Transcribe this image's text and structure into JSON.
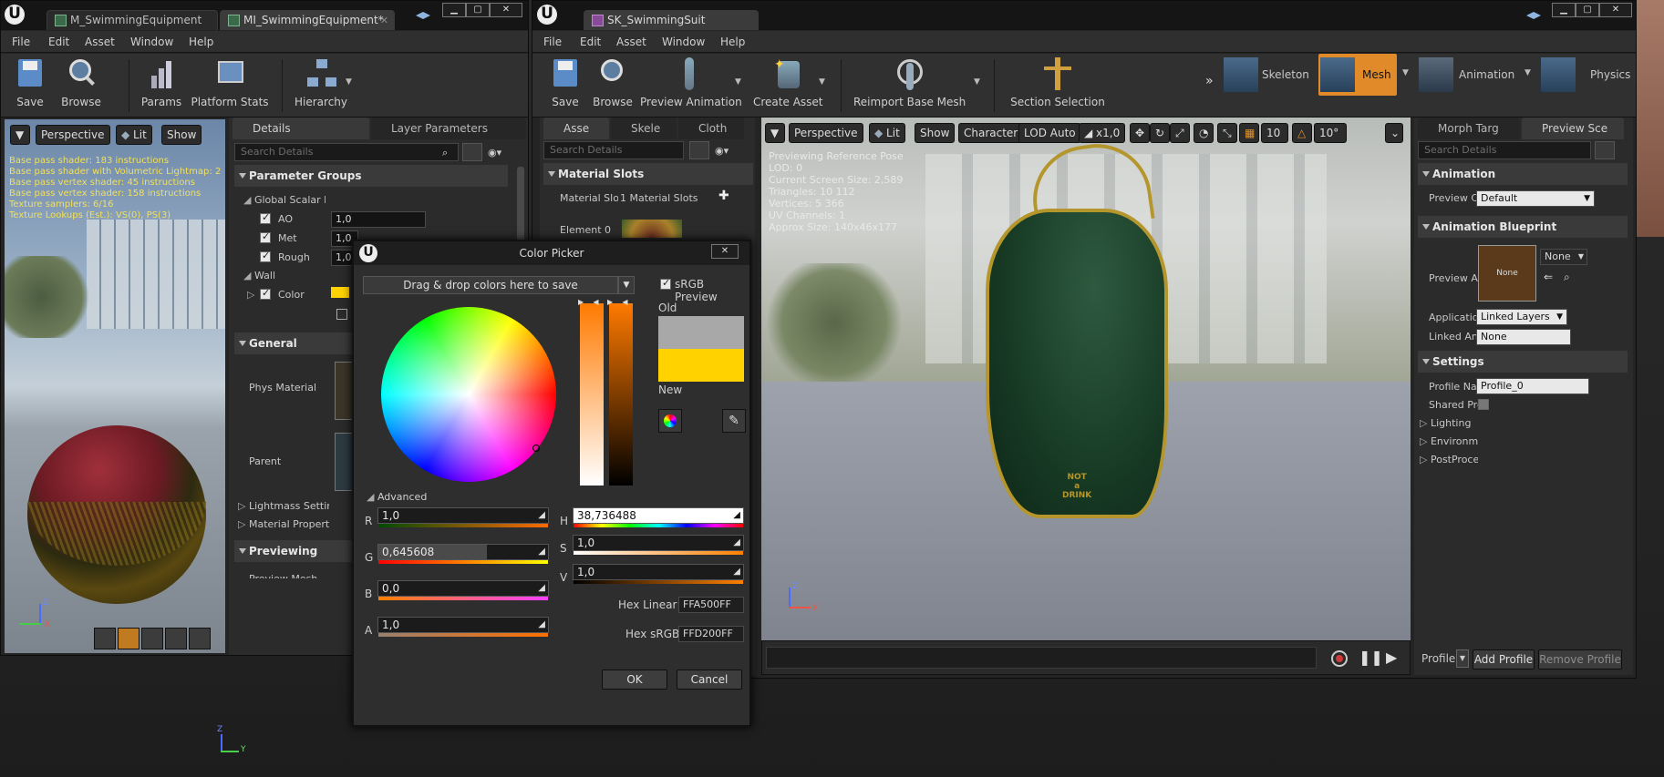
{
  "left_window": {
    "tabs": [
      {
        "label": "M_SwimmingEquipment"
      },
      {
        "label": "MI_SwimmingEquipment*"
      }
    ],
    "menu": [
      "File",
      "Edit",
      "Asset",
      "Window",
      "Help"
    ],
    "toolbar": {
      "save": "Save",
      "browse": "Browse",
      "params": "Params",
      "platform_stats": "Platform Stats",
      "hierarchy": "Hierarchy"
    },
    "viewport": {
      "perspective": "Perspective",
      "lit": "Lit",
      "show": "Show",
      "stats": [
        "Base pass shader: 183 instructions",
        "Base pass shader with Volumetric Lightmap: 2",
        "Base pass vertex shader: 45 instructions",
        "Base pass vertex shader: 158 instructions",
        "Texture samplers: 6/16",
        "Texture Lookups (Est.): VS(0), PS(3)"
      ],
      "axis_x": "X",
      "axis_z": "Z"
    },
    "details": {
      "tab_details": "Details",
      "tab_layer": "Layer Parameters",
      "search_placeholder": "Search Details",
      "parameter_groups": "Parameter Groups",
      "global_scalar": "Global Scalar Pa",
      "params": [
        {
          "name": "AO",
          "value": "1,0"
        },
        {
          "name": "Met",
          "value": "1,0"
        },
        {
          "name": "Rough",
          "value": "1,0"
        }
      ],
      "wall": "Wall",
      "color": "Color",
      "general": "General",
      "phys_material": "Phys Material",
      "parent": "Parent",
      "lightmass": "Lightmass Settir",
      "material_property": "Material Property",
      "previewing": "Previewing",
      "preview_mesh": "Preview Mesh"
    }
  },
  "color_picker": {
    "title": "Color Picker",
    "dragdrop": "Drag & drop colors here to save",
    "srgb_preview": "sRGB Preview",
    "old": "Old",
    "new": "New",
    "advanced": "Advanced",
    "r_label": "R",
    "r": "1,0",
    "g_label": "G",
    "g": "0,645608",
    "b_label": "B",
    "b": "0,0",
    "a_label": "A",
    "a": "1,0",
    "h_label": "H",
    "h": "38,736488",
    "s_label": "S",
    "s": "1,0",
    "v_label": "V",
    "v": "1,0",
    "hex_linear_label": "Hex Linear",
    "hex_linear": "FFA500FF",
    "hex_srgb_label": "Hex sRGB",
    "hex_srgb": "FFD200FF",
    "ok": "OK",
    "cancel": "Cancel",
    "old_color": "#a8a8a8",
    "new_color": "#ffd200"
  },
  "right_window": {
    "tab": "SK_SwimmingSuit",
    "menu": [
      "File",
      "Edit",
      "Asset",
      "Window",
      "Help"
    ],
    "toolbar": {
      "save": "Save",
      "browse": "Browse",
      "preview_animation": "Preview Animation",
      "create_asset": "Create Asset",
      "reimport": "Reimport Base Mesh",
      "section_selection": "Section Selection",
      "skeleton": "Skeleton",
      "mesh": "Mesh",
      "animation": "Animation",
      "physics": "Physics"
    },
    "left_panel": {
      "tabs": [
        "Asse",
        "Skele",
        "Cloth"
      ],
      "search_placeholder": "Search Details",
      "material_slots_cat": "Material Slots",
      "material_slots_label": "Material Slo",
      "material_slots_value": "1 Material Slots",
      "element0": "Element 0"
    },
    "viewport": {
      "perspective": "Perspective",
      "lit": "Lit",
      "show": "Show",
      "character": "Character",
      "lod": "LOD Auto",
      "speed": "x1,0",
      "grid": "10",
      "angle": "10°",
      "info": [
        "Previewing Reference Pose",
        "LOD: 0",
        "Current Screen Size: 2,589",
        "Triangles: 10 112",
        "Vertices: 5 366",
        "UV Channels: 1",
        "Approx Size: 140x46x177"
      ],
      "suit_text": [
        "NOT",
        "a",
        "DRINK"
      ],
      "axis_x": "X",
      "axis_z": "Z"
    },
    "right_panel": {
      "tabs": [
        "Morph Targ",
        "Preview Sce"
      ],
      "search_placeholder": "Search Details",
      "animation_cat": "Animation",
      "preview_co": "Preview Co",
      "preview_co_value": "Default",
      "anim_bp_cat": "Animation Blueprint",
      "preview_ani": "Preview Ani",
      "preview_ani_thumb": "None",
      "preview_ani_value": "None",
      "application": "Application",
      "application_value": "Linked Layers",
      "linked_anim": "Linked Anim",
      "linked_anim_value": "None",
      "settings_cat": "Settings",
      "profile_name": "Profile Nam",
      "profile_name_value": "Profile_0",
      "shared_prof": "Shared Prof",
      "lighting": "Lighting",
      "environment": "Environmer",
      "postprocess": "PostProces",
      "profile": "Profile",
      "add_profile": "Add Profile",
      "remove_profile": "Remove Profile"
    }
  },
  "background": {
    "axis_y": "Y",
    "axis_z": "Z"
  }
}
